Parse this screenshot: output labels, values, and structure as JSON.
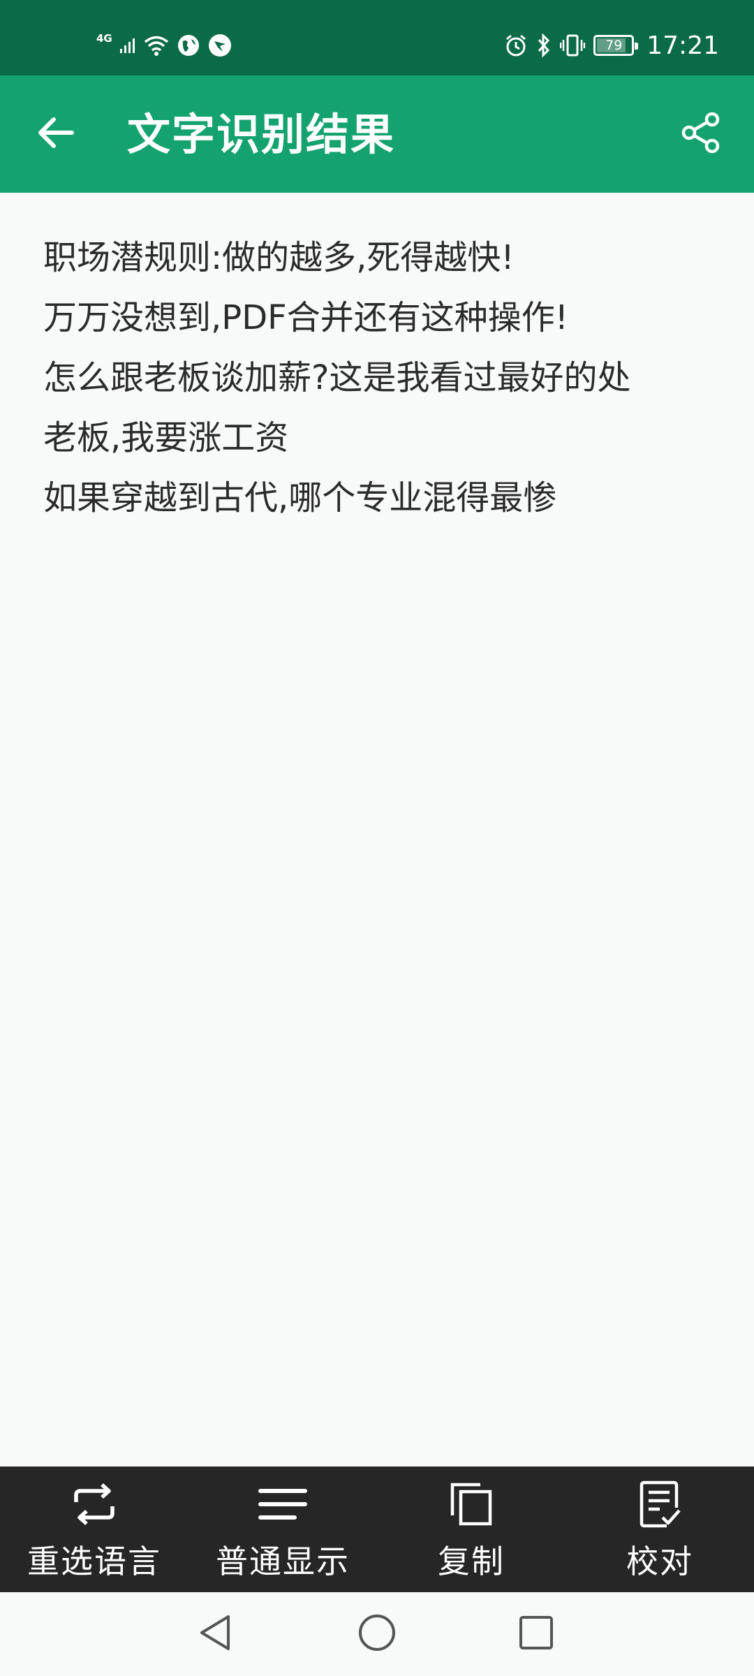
{
  "status_bar": {
    "network_type": "4G",
    "battery_level": "79",
    "time": "17:21",
    "icons": [
      "signal-icon",
      "wifi-icon",
      "globe-icon",
      "notification-icon",
      "alarm-icon",
      "bluetooth-icon",
      "vibrate-icon",
      "battery-icon"
    ]
  },
  "app_bar": {
    "title": "文字识别结果",
    "back_icon": "arrow-left-icon",
    "share_icon": "share-icon",
    "color": "#14a36e"
  },
  "content": {
    "lines": [
      "职场潜规则:做的越多,死得越快!",
      "万万没想到,PDF合并还有这种操作!",
      "怎么跟老板谈加薪?这是我看过最好的处",
      "老板,我要涨工资",
      "如果穿越到古代,哪个专业混得最惨"
    ]
  },
  "toolbar": {
    "items": [
      {
        "label": "重选语言",
        "icon": "repeat-icon"
      },
      {
        "label": "普通显示",
        "icon": "menu-lines-icon"
      },
      {
        "label": "复制",
        "icon": "copy-icon"
      },
      {
        "label": "校对",
        "icon": "proofread-icon"
      }
    ]
  },
  "nav_bar": {
    "icons": [
      "back-triangle-icon",
      "home-circle-icon",
      "recents-square-icon"
    ]
  }
}
